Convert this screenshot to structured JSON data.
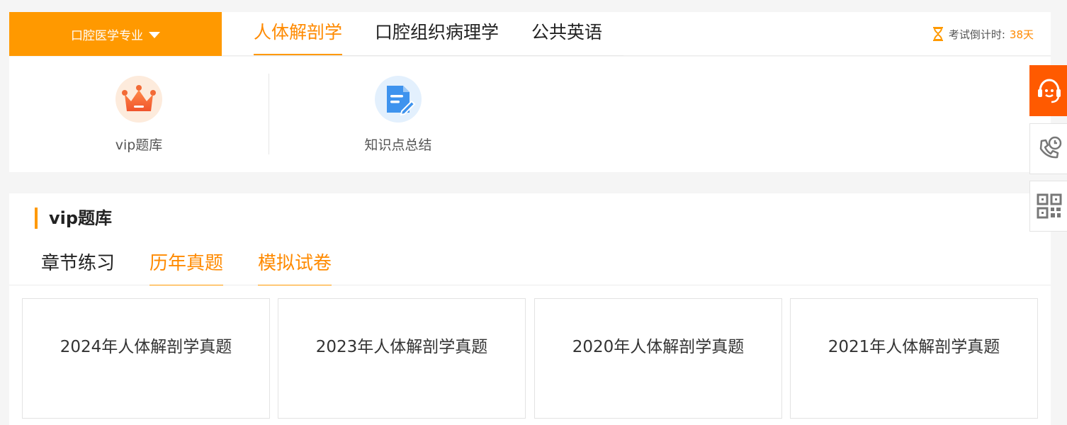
{
  "topbar": {
    "major_label": "口腔医学专业",
    "subjects": [
      "人体解剖学",
      "口腔组织病理学",
      "公共英语"
    ],
    "countdown_label": "考试倒计时:",
    "countdown_value": "38天"
  },
  "tools": {
    "items": [
      {
        "label": "vip题库",
        "icon": "crown-icon"
      },
      {
        "label": "知识点总结",
        "icon": "document-edit-icon"
      }
    ]
  },
  "bank": {
    "title": "vip题库",
    "tabs": [
      "章节练习",
      "历年真题",
      "模拟试卷"
    ],
    "cards": [
      "2024年人体解剖学真题",
      "2023年人体解剖学真题",
      "2020年人体解剖学真题",
      "2021年人体解剖学真题"
    ]
  },
  "float_bar": {
    "items": [
      "customer-service-icon",
      "phone-icon",
      "qrcode-icon"
    ]
  },
  "colors": {
    "accent": "#ff9900",
    "accent_text": "#ff8a00",
    "service_bg": "#ff5a00"
  }
}
